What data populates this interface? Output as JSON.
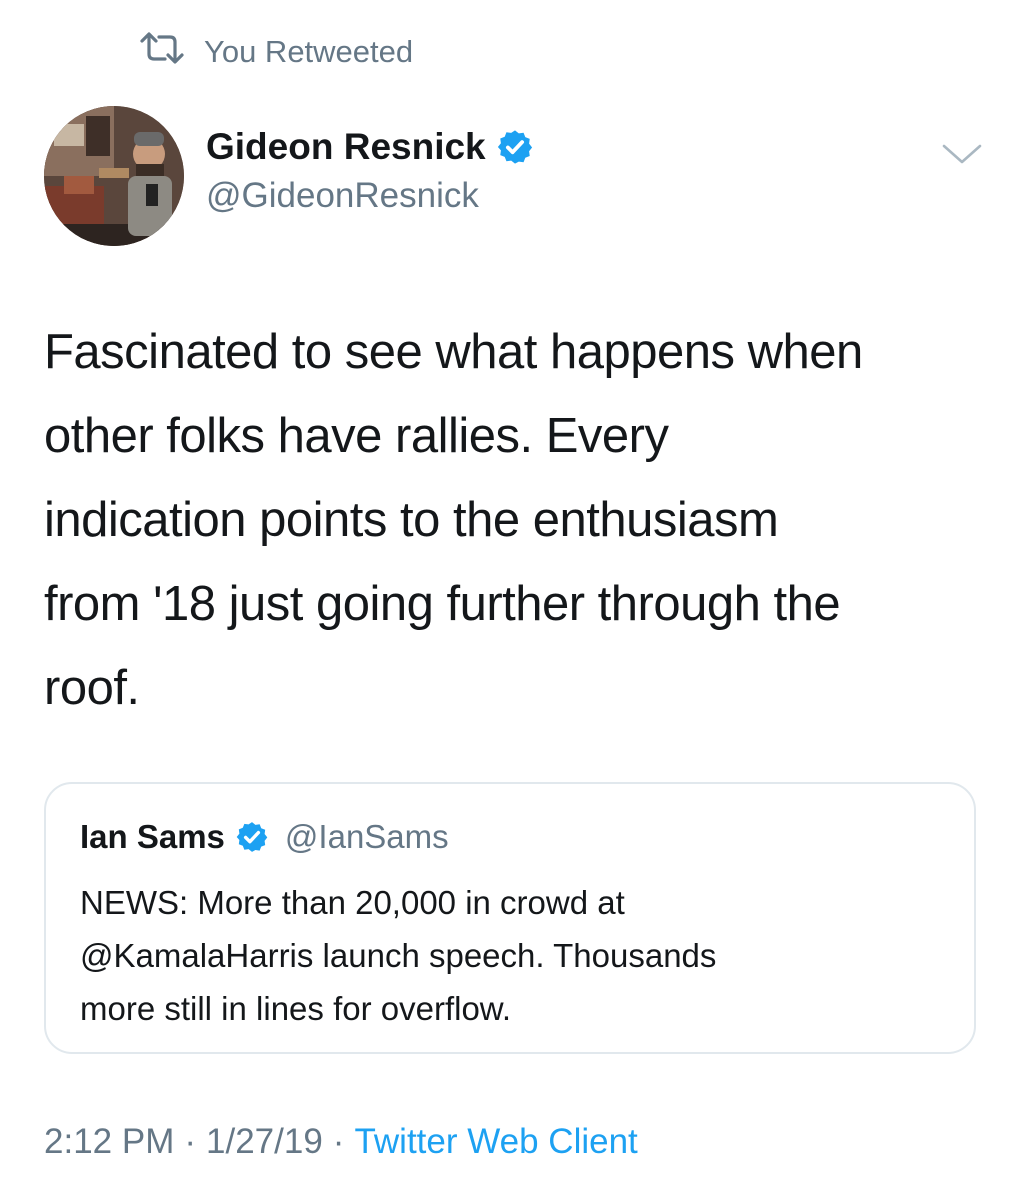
{
  "retweet": {
    "label": "You Retweeted",
    "icon": "retweet-icon"
  },
  "author": {
    "name": "Gideon Resnick",
    "handle": "@GideonResnick",
    "verified_icon": "verified-badge-icon"
  },
  "tweet": {
    "lines": [
      "Fascinated to see what happens when",
      "other folks have rallies. Every",
      "indication points to the enthusiasm",
      "from '18 just going further through the",
      "roof."
    ]
  },
  "quote": {
    "name": "Ian Sams",
    "handle": "@IanSams",
    "lines": [
      "NEWS: More than 20,000 in crowd at",
      "@KamalaHarris launch speech. Thousands",
      "more still in lines for overflow."
    ]
  },
  "footer": {
    "time": "2:12 PM",
    "date": "1/27/19",
    "separator": "·",
    "client": "Twitter Web Client"
  },
  "colors": {
    "accent": "#1da1f2",
    "secondary_text": "#657786",
    "primary_text": "#14171a",
    "border": "#e1e8ed"
  }
}
